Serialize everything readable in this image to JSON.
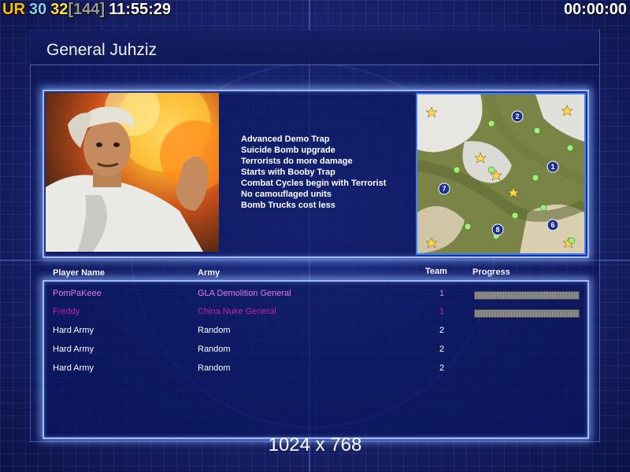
{
  "top_bar": {
    "ur_label": "UR",
    "val_a": "30",
    "val_b": "32",
    "val_c": "[144]",
    "clock": "11:55:29",
    "timer": "00:00:00"
  },
  "general": {
    "title": "General Juhziz",
    "traits": [
      "Advanced Demo Trap",
      "Suicide Bomb upgrade",
      "Terrorists do more damage",
      "Starts with Booby Trap",
      "Combat Cycles begin with Terrorist",
      "No camouflaged units",
      "Bomb Trucks cost less"
    ]
  },
  "map": {
    "player_markers": [
      "1",
      "2",
      "6",
      "7",
      "8"
    ]
  },
  "players_table": {
    "headers": {
      "name": "Player Name",
      "army": "Army",
      "team": "Team",
      "progress": "Progress"
    },
    "rows": [
      {
        "name": "PomPaKeee",
        "army": "GLA Demolition General",
        "team": "1",
        "color": "#e07be8",
        "progress": 1.0
      },
      {
        "name": "Freddy",
        "army": "China Nuke General",
        "team": "1",
        "color": "#c81fb0",
        "progress": 1.0
      },
      {
        "name": "Hard Army",
        "army": "Random",
        "team": "2",
        "color": "#ffffff"
      },
      {
        "name": "Hard Army",
        "army": "Random",
        "team": "2",
        "color": "#ffffff"
      },
      {
        "name": "Hard Army",
        "army": "Random",
        "team": "2",
        "color": "#ffffff"
      }
    ]
  },
  "resolution": "1024 x 768",
  "colors": {
    "ur": "#ffc000",
    "val_a": "#7fd0ff",
    "val_b": "#ffe04a",
    "val_c": "#9a9a9a"
  }
}
